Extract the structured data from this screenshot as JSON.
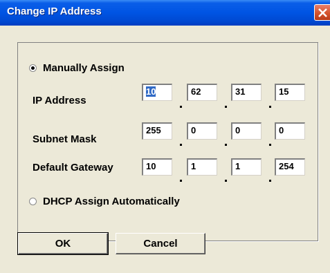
{
  "window": {
    "title": "Change IP Address"
  },
  "manual": {
    "label": "Manually Assign",
    "checked": true
  },
  "dhcp": {
    "label": "DHCP Assign Automatically",
    "checked": false
  },
  "fields": [
    {
      "label": "IP Address",
      "octets": [
        "10",
        "62",
        "31",
        "15"
      ]
    },
    {
      "label": "Subnet Mask",
      "octets": [
        "255",
        "0",
        "0",
        "0"
      ]
    },
    {
      "label": "Default Gateway",
      "octets": [
        "10",
        "1",
        "1",
        "254"
      ]
    }
  ],
  "buttons": {
    "ok": "OK",
    "cancel": "Cancel"
  },
  "icons": {
    "close": "close-icon"
  }
}
